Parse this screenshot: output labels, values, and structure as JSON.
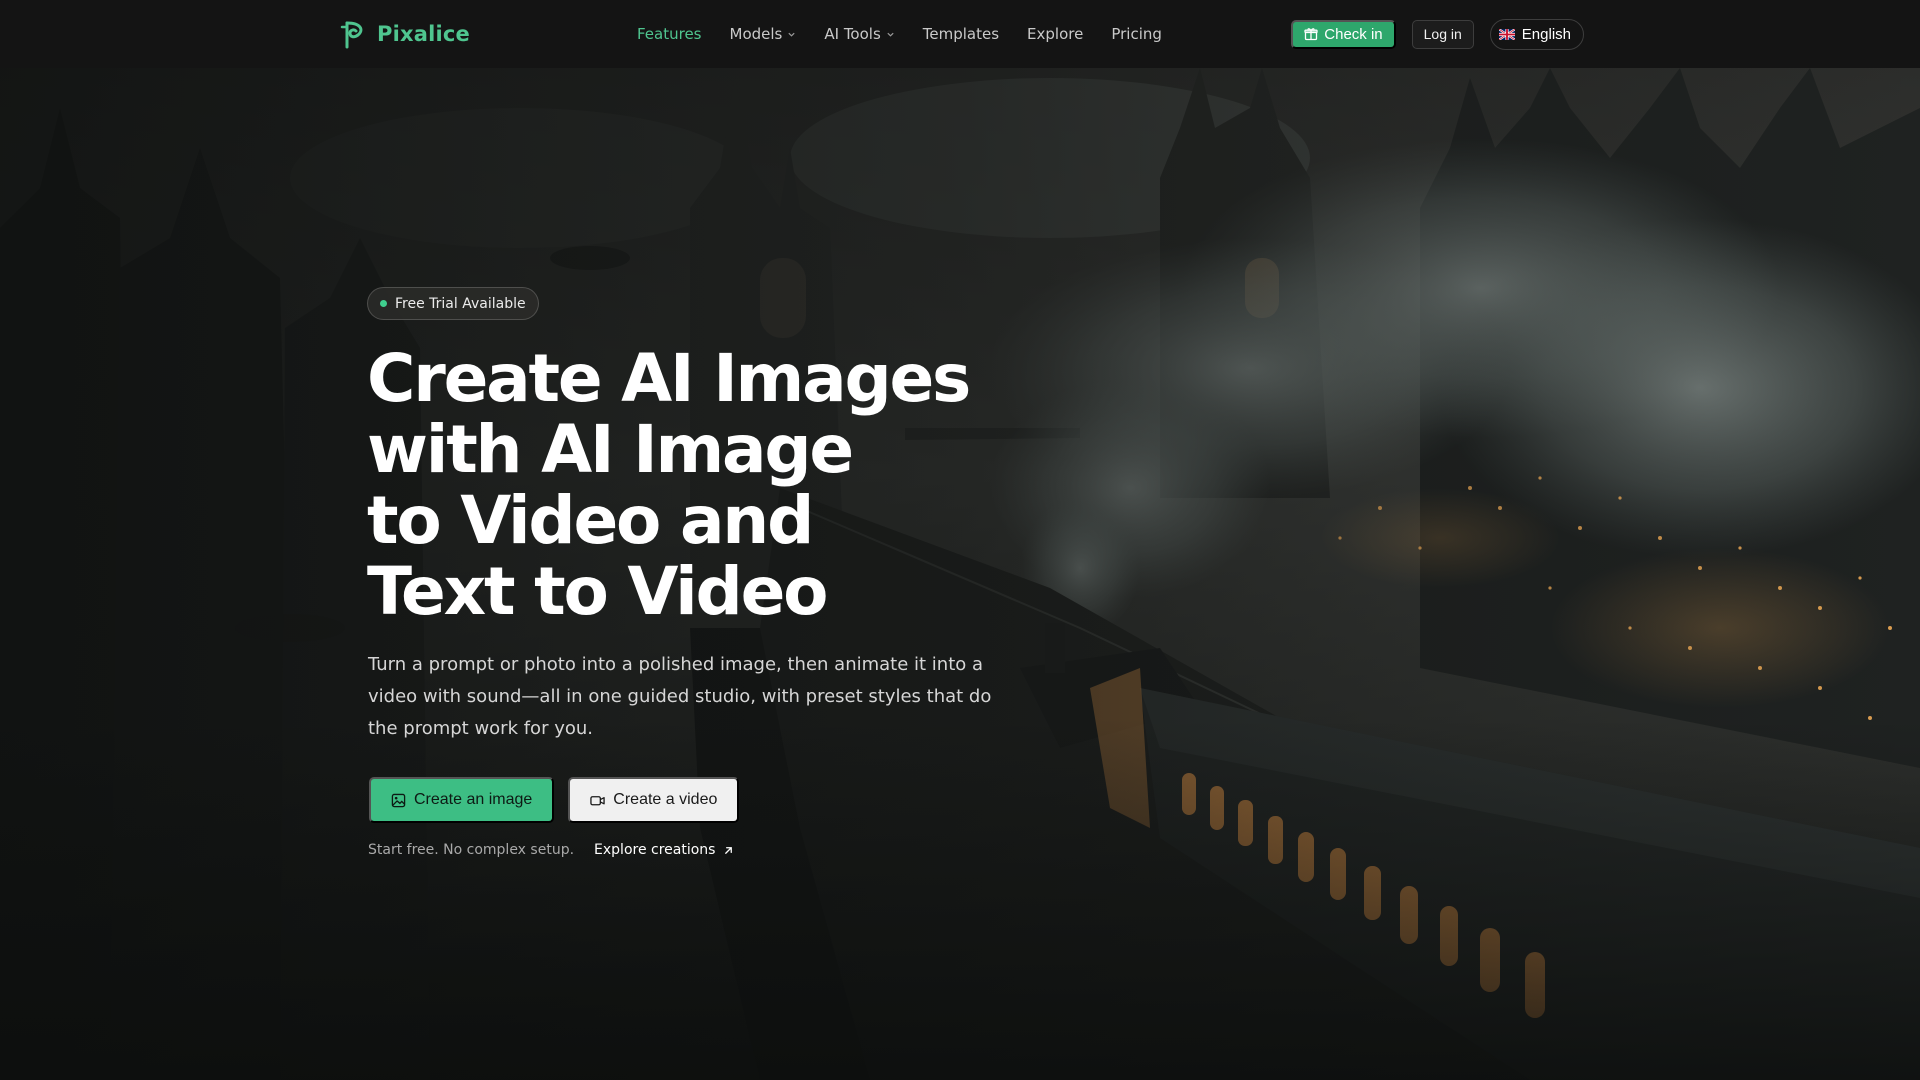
{
  "brand": {
    "name": "Pixalice",
    "logo_icon": "pixalice-logo-icon",
    "accent": "#4fc58f"
  },
  "nav": {
    "links": [
      {
        "label": "Features",
        "active": true
      },
      {
        "label": "Models",
        "dropdown": true
      },
      {
        "label": "AI Tools",
        "dropdown": true
      },
      {
        "label": "Templates"
      },
      {
        "label": "Explore"
      },
      {
        "label": "Pricing"
      }
    ],
    "checkin_label": "Check in",
    "checkin_icon": "gift-icon",
    "login_label": "Log in",
    "language_label": "English",
    "language_icon": "uk-flag-icon"
  },
  "hero": {
    "badge": "Free Trial Available",
    "headline_lines": [
      "Create AI Images",
      "with AI Image",
      "to Video and",
      "Text to Video"
    ],
    "subtext": "Turn a prompt or photo into a polished image, then animate it into a video with sound—all in one guided studio, with preset styles that do the prompt work for you.",
    "primary_cta": {
      "label": "Create an image",
      "icon": "image-icon"
    },
    "secondary_cta": {
      "label": "Create a video",
      "icon": "video-camera-icon"
    },
    "footnote": "Start free. No complex setup.",
    "explore_link": {
      "label": "Explore creations",
      "icon": "arrow-up-right-icon"
    }
  },
  "colors": {
    "primary_button": "#3dbe84",
    "checkin_button": "#2ea76c",
    "navbar_bg": "#141414"
  }
}
